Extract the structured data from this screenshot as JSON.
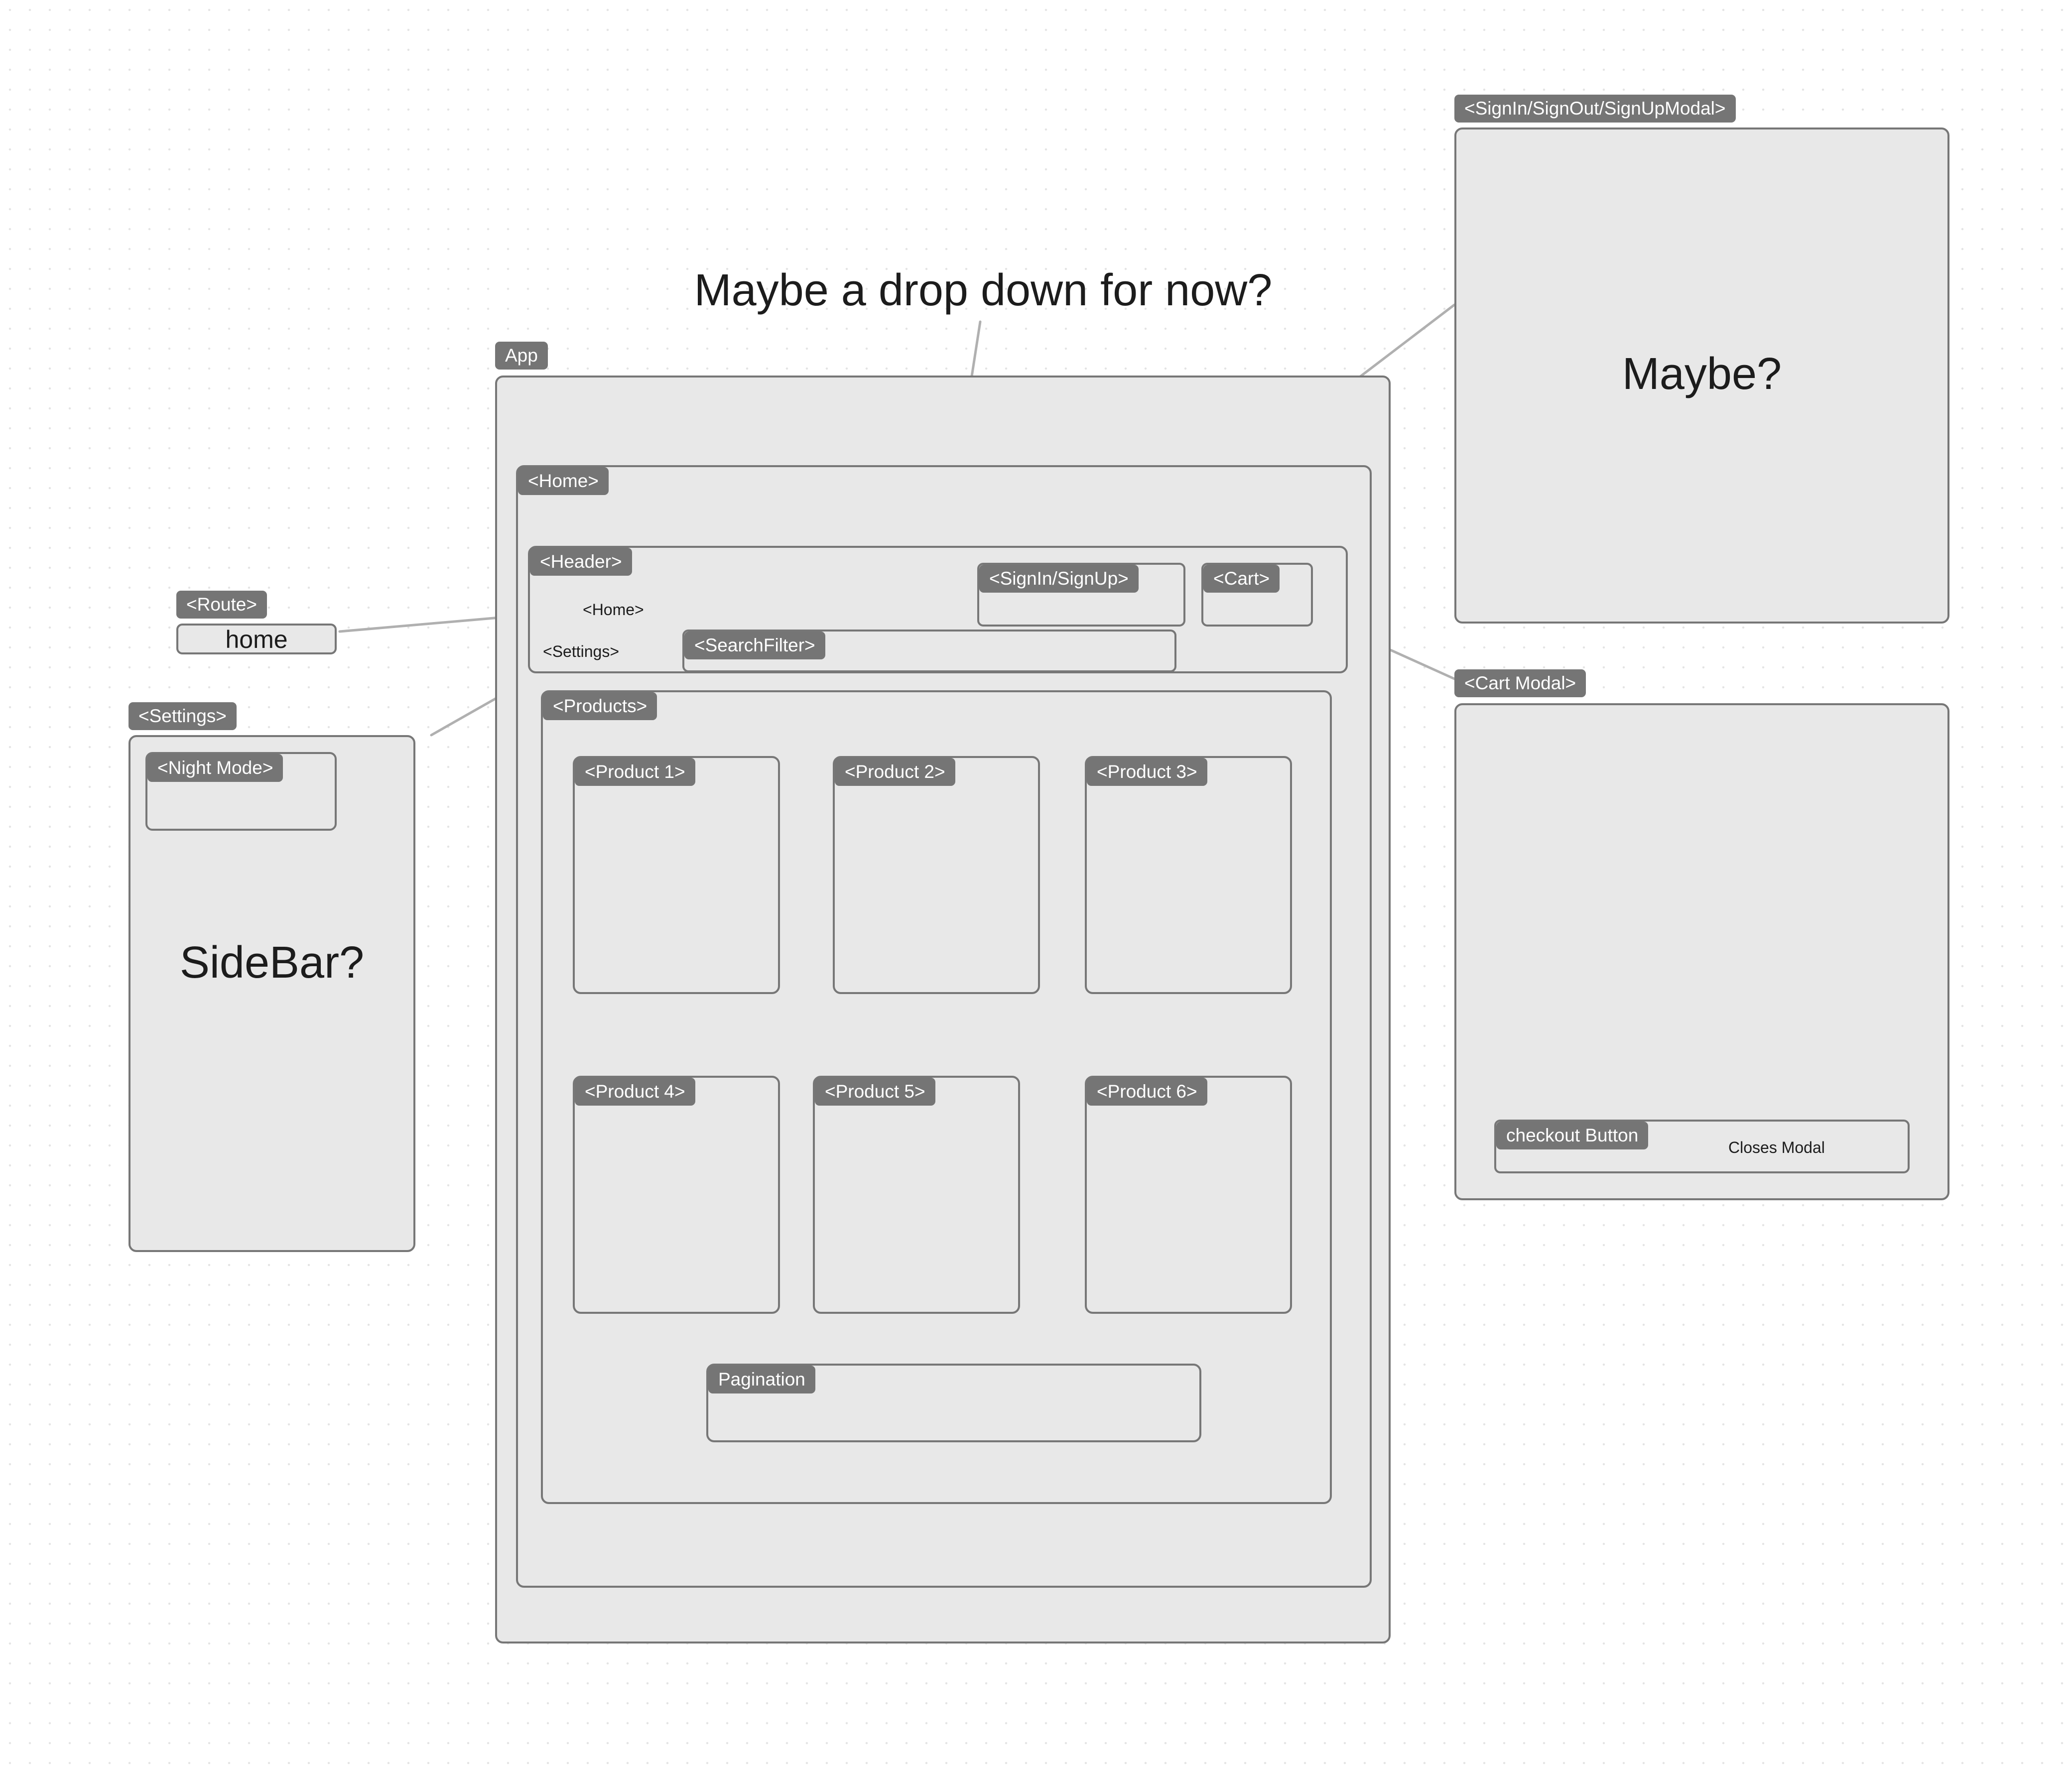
{
  "colors": {
    "frame_fill": "#e8e8e8",
    "frame_border": "#777777",
    "tag_fill": "#757575",
    "tag_text": "#ffffff",
    "connector": "#b0b0b0",
    "background": "#ffffff"
  },
  "annotations": {
    "dropdown_note": "Maybe a drop down for now?",
    "modal_note": "Maybe?",
    "sidebar_note": "SideBar?",
    "closes_modal_note": "Closes Modal"
  },
  "app": {
    "label": "App",
    "home": {
      "label": "<Home>",
      "header": {
        "label": "<Header>",
        "home_link": "<Home>",
        "settings_link": "<Settings>",
        "signin_label": "<SignIn/SignUp>",
        "cart_label": "<Cart>",
        "search_label": "<SearchFilter>"
      },
      "products": {
        "label": "<Products>",
        "items": [
          {
            "label": "<Product 1>"
          },
          {
            "label": "<Product 2>"
          },
          {
            "label": "<Product 3>"
          },
          {
            "label": "<Product 4>"
          },
          {
            "label": "<Product 5>"
          },
          {
            "label": "<Product 6>"
          }
        ],
        "pagination_label": "Pagination"
      }
    }
  },
  "route": {
    "label": "<Route>",
    "value": "home"
  },
  "settings_panel": {
    "label": "<Settings>",
    "night_mode_label": "<Night Mode>"
  },
  "auth_modal": {
    "label": "<SignIn/SignOut/SignUpModal>"
  },
  "cart_modal": {
    "label": "<Cart Modal>",
    "checkout_label": "checkout Button"
  }
}
